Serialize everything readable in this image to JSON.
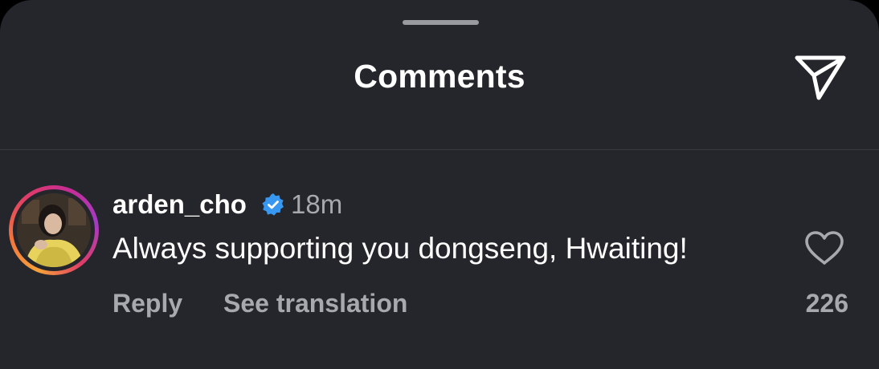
{
  "header": {
    "title": "Comments",
    "share_icon": "send-paper-plane-icon"
  },
  "comment": {
    "username": "arden_cho",
    "verified": true,
    "verified_icon": "verified-badge-icon",
    "timestamp": "18m",
    "text": "Always supporting you dongseng, Hwaiting!",
    "reply_label": "Reply",
    "translate_label": "See translation",
    "like_icon": "heart-outline-icon",
    "like_count": "226"
  },
  "colors": {
    "background": "#25262b",
    "text_primary": "#ffffff",
    "text_secondary": "#a8a9ae",
    "verified_blue": "#3897f0",
    "story_ring": [
      "#f6a13a",
      "#e03c68",
      "#a33bc4"
    ]
  }
}
